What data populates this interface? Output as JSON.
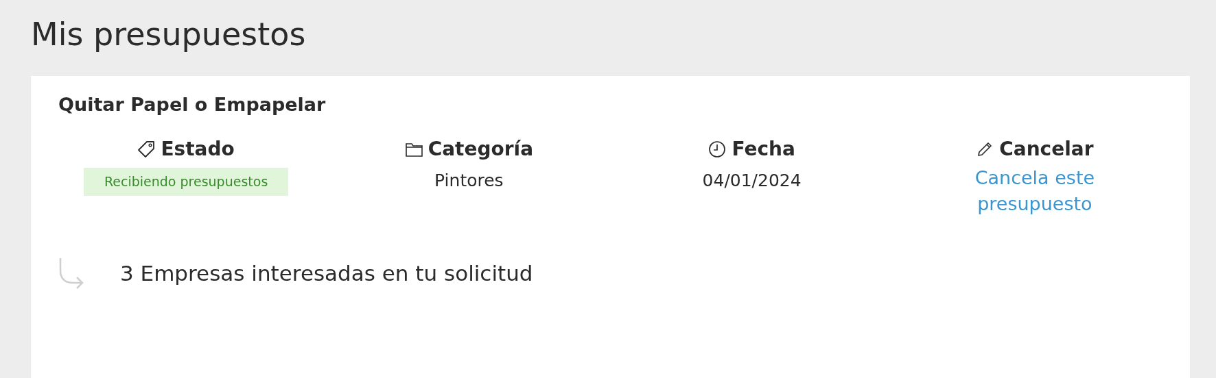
{
  "page_title": "Mis presupuestos",
  "request": {
    "title": "Quitar Papel o Empapelar",
    "fields": [
      {
        "kind": "status",
        "label": "Estado",
        "value": "Recibiendo presupuestos"
      },
      {
        "kind": "category",
        "label": "Categoría",
        "value": "Pintores"
      },
      {
        "kind": "date",
        "label": "Fecha",
        "value": "04/01/2024"
      },
      {
        "kind": "cancel",
        "label": "Cancelar",
        "value": "Cancela este presupuesto"
      }
    ],
    "interested": "3 Empresas interesadas en tu solicitud"
  }
}
